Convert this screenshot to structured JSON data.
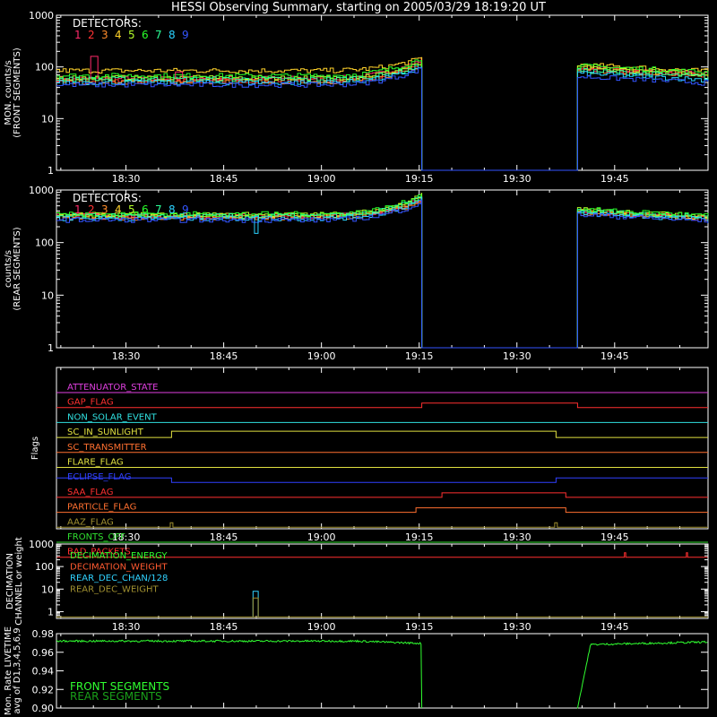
{
  "title": "HESSI Observing Summary, starting on 2005/03/29 18:19:20 UT",
  "time_ticks": [
    "18:30",
    "18:45",
    "19:00",
    "19:15",
    "19:30",
    "19:45"
  ],
  "time_tick_minutes": [
    30,
    45,
    60,
    75,
    90,
    105
  ],
  "time_range_minutes": [
    19.333,
    119.333
  ],
  "chart_data": [
    {
      "type": "line",
      "panel": "front_rates",
      "ylabel": "MON. counts/s\n(FRONT SEGMENTS)",
      "yscale": "log",
      "ylim": [
        1,
        1000
      ],
      "ytick_labels": [
        "1",
        "10",
        "100",
        "1000"
      ],
      "legend_title": "DETECTORS:",
      "legend_placement": "top-left",
      "data_gap_minutes": [
        75.4,
        99.3
      ],
      "series": [
        {
          "name": "1",
          "color": "#ff2a6a",
          "level": 60,
          "x_rise": [
            75.4,
            140
          ],
          "x_after": [
            99.3,
            95
          ]
        },
        {
          "name": "2",
          "color": "#ff3333",
          "level": 55,
          "x_rise": [
            75.4,
            120
          ],
          "x_after": [
            99.3,
            90
          ]
        },
        {
          "name": "3",
          "color": "#ff8c2a",
          "level": 52,
          "x_rise": [
            75.4,
            115
          ],
          "x_after": [
            99.3,
            88
          ]
        },
        {
          "name": "4",
          "color": "#ffd22a",
          "level": 85,
          "x_rise": [
            75.4,
            150
          ],
          "x_after": [
            99.3,
            110
          ]
        },
        {
          "name": "5",
          "color": "#b4ff2a",
          "level": 62,
          "x_rise": [
            75.4,
            120
          ],
          "x_after": [
            99.3,
            95
          ]
        },
        {
          "name": "6",
          "color": "#2aff2a",
          "level": 68,
          "x_rise": [
            75.4,
            150
          ],
          "x_after": [
            99.3,
            105
          ]
        },
        {
          "name": "7",
          "color": "#2aff96",
          "level": 58,
          "x_rise": [
            75.4,
            110
          ],
          "x_after": [
            99.3,
            85
          ]
        },
        {
          "name": "8",
          "color": "#2ad2ff",
          "level": 50,
          "x_rise": [
            75.4,
            100
          ],
          "x_after": [
            99.3,
            75
          ]
        },
        {
          "name": "9",
          "color": "#3355ff",
          "level": 45,
          "x_rise": [
            75.4,
            95
          ],
          "x_after": [
            99.3,
            65
          ]
        }
      ],
      "spikes": [
        {
          "series": "1",
          "x": 25,
          "y": 160
        },
        {
          "series": "1",
          "x": 38,
          "y": 80
        }
      ]
    },
    {
      "type": "line",
      "panel": "rear_rates",
      "ylabel": "counts/s\n(REAR SEGMENTS)",
      "yscale": "log",
      "ylim": [
        1,
        1000
      ],
      "ytick_labels": [
        "1",
        "10",
        "100",
        "1000"
      ],
      "legend_title": "DETECTORS:",
      "legend_placement": "top-left",
      "data_gap_minutes": [
        75.4,
        99.3
      ],
      "series": [
        {
          "name": "1",
          "color": "#ff2a6a",
          "level": 320,
          "x_rise": [
            75.4,
            700
          ],
          "x_after": [
            99.3,
            390
          ]
        },
        {
          "name": "2",
          "color": "#ff3333",
          "level": 310,
          "x_rise": [
            75.4,
            650
          ],
          "x_after": [
            99.3,
            380
          ]
        },
        {
          "name": "3",
          "color": "#ff8c2a",
          "level": 300,
          "x_rise": [
            75.4,
            620
          ],
          "x_after": [
            99.3,
            370
          ]
        },
        {
          "name": "4",
          "color": "#ffd22a",
          "level": 330,
          "x_rise": [
            75.4,
            720
          ],
          "x_after": [
            99.3,
            400
          ]
        },
        {
          "name": "5",
          "color": "#b4ff2a",
          "level": 340,
          "x_rise": [
            75.4,
            800
          ],
          "x_after": [
            99.3,
            420
          ]
        },
        {
          "name": "6",
          "color": "#2aff2a",
          "level": 350,
          "x_rise": [
            75.4,
            820
          ],
          "x_after": [
            99.3,
            430
          ]
        },
        {
          "name": "7",
          "color": "#2aff96",
          "level": 320,
          "x_rise": [
            75.4,
            760
          ],
          "x_after": [
            99.3,
            400
          ]
        },
        {
          "name": "8",
          "color": "#2ad2ff",
          "level": 290,
          "x_rise": [
            75.4,
            680
          ],
          "x_after": [
            99.3,
            360
          ]
        },
        {
          "name": "9",
          "color": "#3355ff",
          "level": 270,
          "x_rise": [
            75.4,
            600
          ],
          "x_after": [
            99.3,
            340
          ]
        }
      ],
      "dip": {
        "x": 50,
        "y": 150
      }
    },
    {
      "type": "line",
      "panel": "flags",
      "ylabel": "Flags",
      "flags": [
        {
          "name": "ATTENUATOR_STATE",
          "color": "#e040e0",
          "on": []
        },
        {
          "name": "GAP_FLAG",
          "color": "#ff3030",
          "on": [
            [
              75.4,
              99.3
            ]
          ]
        },
        {
          "name": "NON_SOLAR_EVENT",
          "color": "#30e0e0",
          "on": []
        },
        {
          "name": "SC_IN_SUNLIGHT",
          "color": "#e0e040",
          "on": [
            [
              19.333,
              37.0
            ],
            [
              96.0,
              119.333
            ]
          ],
          "high_default": false,
          "low_segment": [
            37.0,
            96.0
          ]
        },
        {
          "name": "SC_TRANSMITTER",
          "color": "#ff7030",
          "on": []
        },
        {
          "name": "FLARE_FLAG",
          "color": "#e0e040",
          "on": []
        },
        {
          "name": "ECLIPSE_FLAG",
          "color": "#3040ff",
          "on": [
            [
              19.333,
              37.0
            ],
            [
              96.0,
              119.333
            ]
          ]
        },
        {
          "name": "SAA_FLAG",
          "color": "#ff3030",
          "on": [
            [
              78.5,
              97.5
            ]
          ]
        },
        {
          "name": "PARTICLE_FLAG",
          "color": "#ff7030",
          "on": [
            [
              74.5,
              97.5
            ]
          ]
        },
        {
          "name": "AAZ_FLAG",
          "color": "#a09030",
          "on": [
            [
              36.8,
              37.2
            ],
            [
              95.8,
              96.2
            ]
          ]
        },
        {
          "name": "FRONTS_OFF",
          "color": "#30e030",
          "on": []
        },
        {
          "name": "BAD_PACKETS",
          "color": "#ff3030",
          "on": [
            [
              106.5,
              106.7
            ],
            [
              116.0,
              116.2
            ]
          ]
        }
      ]
    },
    {
      "type": "line",
      "panel": "decimation",
      "ylabel": "DECIMATION\nCHANNEL or weight",
      "yscale": "log",
      "ylim": [
        0.5,
        1000
      ],
      "ytick_labels": [
        "1",
        "10",
        "100",
        "1000"
      ],
      "legend_placement": "top-left",
      "series": [
        {
          "name": "DECIMATION_ENERGY",
          "color": "#30ff30"
        },
        {
          "name": "DECIMATION_WEIGHT",
          "color": "#ff5a30"
        },
        {
          "name": "REAR_DEC_CHAN/128",
          "color": "#30d2ff"
        },
        {
          "name": "REAR_DEC_WEIGHT",
          "color": "#a09030"
        }
      ],
      "pulses": [
        {
          "series": "REAR_DEC_CHAN/128",
          "x": [
            49.5,
            50.3
          ],
          "y": 8
        },
        {
          "series": "REAR_DEC_WEIGHT",
          "x": [
            49.5,
            50.3
          ],
          "y": 4
        }
      ]
    },
    {
      "type": "line",
      "panel": "livetime",
      "ylabel": "Mon. Rate LIVETIME\navg of D1,3,4,5,6,9",
      "ylim": [
        0.9,
        0.98
      ],
      "ytick_labels": [
        "0.90",
        "0.92",
        "0.94",
        "0.96",
        "0.98"
      ],
      "legend_placement": "bottom-left",
      "series": [
        {
          "name": "FRONT SEGMENTS",
          "color": "#30ff30",
          "level": 0.972
        },
        {
          "name": "REAR SEGMENTS",
          "color": "#1aa01a",
          "level": 0.971
        }
      ],
      "data_gap_minutes": [
        75.4,
        99.3
      ]
    }
  ]
}
